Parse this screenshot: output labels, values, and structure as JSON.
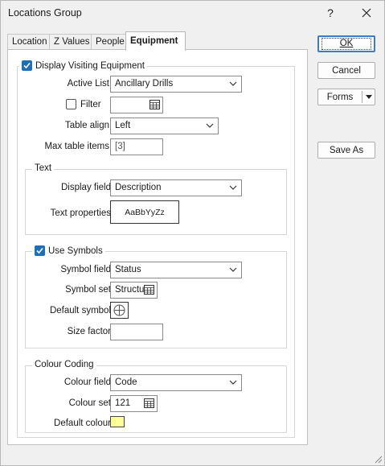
{
  "window": {
    "title": "Locations Group"
  },
  "tabs": [
    {
      "label": "Location"
    },
    {
      "label": "Z Values"
    },
    {
      "label": "People"
    },
    {
      "label": "Equipment"
    }
  ],
  "equipment": {
    "display_visiting": {
      "label": "Display Visiting Equipment",
      "checked": true
    },
    "active_list": {
      "label": "Active List",
      "value": "Ancillary Drills"
    },
    "filter": {
      "label": "Filter",
      "checked": false,
      "value": ""
    },
    "table_align": {
      "label": "Table align",
      "value": "Left"
    },
    "max_table_items": {
      "label": "Max table items",
      "value": "[3]"
    },
    "text_group": {
      "legend": "Text",
      "display_field": {
        "label": "Display field",
        "value": "Description"
      },
      "text_properties": {
        "label": "Text properties",
        "sample": "AaBbYyZz"
      }
    },
    "symbols_group": {
      "legend": "Use Symbols",
      "checked": true,
      "symbol_field": {
        "label": "Symbol field",
        "value": "Status"
      },
      "symbol_set": {
        "label": "Symbol set",
        "value": "Structu"
      },
      "default_symbol": {
        "label": "Default symbol"
      },
      "size_factor": {
        "label": "Size factor",
        "value": ""
      }
    },
    "colour_group": {
      "legend": "Colour Coding",
      "colour_field": {
        "label": "Colour field",
        "value": "Code"
      },
      "colour_set": {
        "label": "Colour set",
        "value": "121"
      },
      "default_colour": {
        "label": "Default colour",
        "color": "#ffff99"
      }
    }
  },
  "buttons": {
    "ok": "OK",
    "cancel": "Cancel",
    "forms": "Forms",
    "save_as": "Save As"
  },
  "colors": {
    "accent": "#1f6fb8",
    "focus_border": "#3d7ccb"
  }
}
